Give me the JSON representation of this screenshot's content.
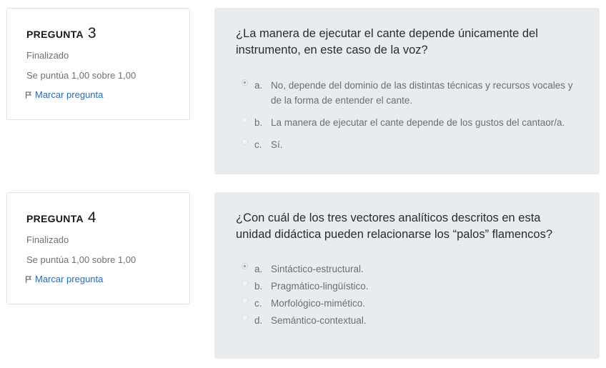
{
  "questions": [
    {
      "label": "PREGUNTA",
      "number": "3",
      "state": "Finalizado",
      "grade": "Se puntúa 1,00 sobre 1,00",
      "flag_label": "Marcar pregunta",
      "text": "¿La manera de ejecutar el cante depende únicamente del instrumento, en este caso de la voz?",
      "answers": [
        {
          "letter": "a.",
          "text": "No, depende del dominio de las distintas técnicas y recursos vocales y de la forma de entender el cante.",
          "selected": true
        },
        {
          "letter": "b.",
          "text": "La manera de ejecutar el cante depende de los gustos del cantaor/a.",
          "selected": false
        },
        {
          "letter": "c.",
          "text": "Sí.",
          "selected": false
        }
      ]
    },
    {
      "label": "PREGUNTA",
      "number": "4",
      "state": "Finalizado",
      "grade": "Se puntúa 1,00 sobre 1,00",
      "flag_label": "Marcar pregunta",
      "text": "¿Con cuál de los tres vectores analíticos descritos en esta unidad didáctica pueden relacionarse los “palos” flamencos?",
      "answers": [
        {
          "letter": "a.",
          "text": "Sintáctico-estructural.",
          "selected": true
        },
        {
          "letter": "b.",
          "text": "Pragmático-lingüístico.",
          "selected": false
        },
        {
          "letter": "c.",
          "text": "Morfológico-mimético.",
          "selected": false
        },
        {
          "letter": "d.",
          "text": "Semántico-contextual.",
          "selected": false
        }
      ]
    }
  ],
  "icons": {
    "flag": "flag-icon",
    "radio": "radio-icon"
  },
  "colors": {
    "link": "#2a6bb0",
    "content_bg": "#e9ecef",
    "muted_text": "#6a737b"
  }
}
